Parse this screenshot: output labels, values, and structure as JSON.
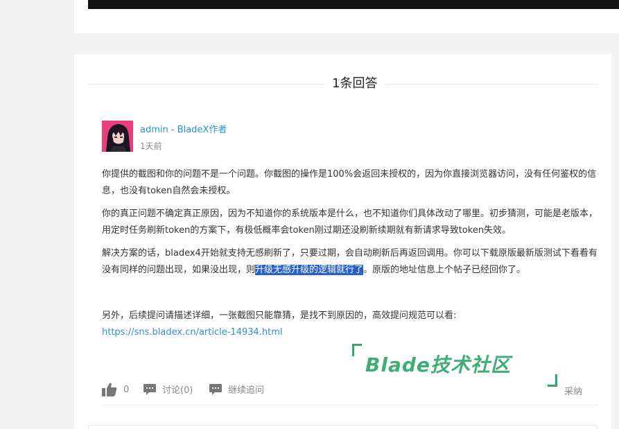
{
  "answers": {
    "count_title": "1条回答",
    "items": [
      {
        "author": "admin - BladeX作者",
        "time": "1天前",
        "paragraphs": [
          "你提供的截图和你的问题不是一个问题。你截图的操作是100%会返回未授权的，因为你直接浏览器访问，没有任何鉴权的信息，也没有token自然会未授权。",
          "你的真正问题不确定真正原因，因为不知道你的系统版本是什么，也不知道你们具体改动了哪里。初步猜测，可能是老版本，用定时任务刷新token的方案下，有极低概率会token刚过期还没刷新续期就有新请求导致token失效。"
        ],
        "p3_before": "解决方案的话，bladex4开始就支持无感刷新了，只要过期，会自动刷新后再返回调用。你可以下载原版最新版测试下看看有没有同样的问题出现，如果没出现，则",
        "p3_highlight": "升级无感升级的逻辑就行了",
        "p3_after": "。原版的地址信息上个帖子已经回你了。",
        "p4": "另外，后续提问请描述详细，一张截图只能靠猜，是找不到原因的，高效提问规范可以看:",
        "link": "https://sns.bladex.cn/article-14934.html",
        "watermark": "Blade技术社区",
        "likes": "0",
        "discuss_label": "讨论(0)",
        "follow_label": "继续追问",
        "adopt_label": "采纳"
      }
    ]
  },
  "colors": {
    "accent": "#2497cf",
    "highlight": "#2860c9",
    "watermark": "#3fae74",
    "avatar_bg": "#e8407a"
  }
}
